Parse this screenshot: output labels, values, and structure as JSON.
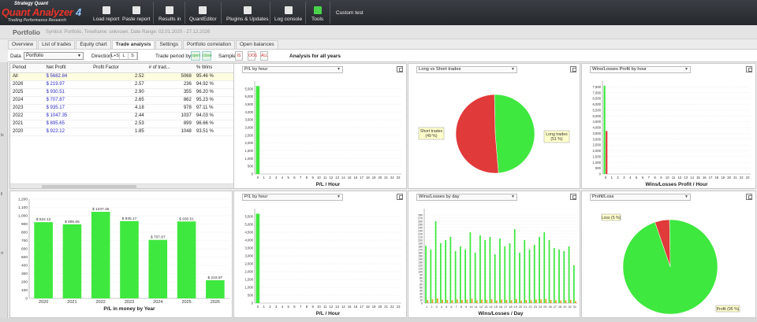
{
  "toolbar": {
    "logo": {
      "line1": "Strategy Quant",
      "line2": "Quant Analyzer",
      "line2_num": "4",
      "line3": "Trading Performance Research"
    },
    "buttons": [
      {
        "label": "Load report",
        "icon": "folder-open-icon"
      },
      {
        "label": "Paste report",
        "icon": "clipboard-icon"
      },
      {
        "label": "Results in",
        "icon": "results-icon"
      },
      {
        "label": "QuantEditor",
        "icon": "editor-icon"
      },
      {
        "label": "Plugins & Updates",
        "icon": "plugin-icon"
      },
      {
        "label": "Log console",
        "icon": "console-icon"
      },
      {
        "label": "Tools",
        "icon": "check-icon"
      },
      {
        "label": "Custom test",
        "icon": ""
      }
    ]
  },
  "header": {
    "title": "Portfolio",
    "meta": "Symbol: Portfolio, Timeframe: unknown, Date Range: 02.01.2020 - 27.12.2026"
  },
  "tabs": [
    "Overview",
    "List of trades",
    "Equity chart",
    "Trade analysis",
    "Settings",
    "Portfolio correlation",
    "Open balances"
  ],
  "active_tab": "Trade analysis",
  "filters": {
    "data_label": "Data",
    "data_value": "Portfolio",
    "direction_label": "Direction",
    "directions": [
      "L+S",
      "L",
      "S"
    ],
    "trade_period_label": "Trade period by",
    "trade_period_open": "open",
    "trade_period_close": "close",
    "sample_label": "Sample",
    "sample_icons": [
      "IS",
      "OOS",
      "ALL"
    ],
    "analysis_title": "Analysis for all years"
  },
  "left_strip": {
    "labels": [
      "ls",
      "ll",
      "rt"
    ]
  },
  "table": {
    "columns": [
      "Period",
      "Net Profit",
      "Profit Factor",
      "# of trad...",
      "% Wins"
    ],
    "rows": [
      [
        "All",
        "$ 5682.84",
        "2.52",
        "5068",
        "95.46 %"
      ],
      [
        "2026",
        "$ 219.97",
        "2.57",
        "236",
        "94.92 %"
      ],
      [
        "2025",
        "$ 930.51",
        "2.90",
        "355",
        "96.20 %"
      ],
      [
        "2024",
        "$ 707.87",
        "2.65",
        "862",
        "95.23 %"
      ],
      [
        "2023",
        "$ 935.17",
        "4.18",
        "978",
        "97.11 %"
      ],
      [
        "2022",
        "$ 1047.35",
        "2.44",
        "1037",
        "94.03 %"
      ],
      [
        "2021",
        "$ 895.65",
        "2.53",
        "899",
        "96.66 %"
      ],
      [
        "2020",
        "$ 922.12",
        "1.85",
        "1048",
        "93.51 %"
      ]
    ]
  },
  "panels": {
    "pl_hour_top": {
      "title": "P/L by hour",
      "xlabel": "P/L / Hour"
    },
    "long_short": {
      "title": "Long vs Short trades",
      "labels": [
        "Short trades",
        "Long trades"
      ],
      "sublabels": [
        "(49 %)",
        "(51 %)"
      ]
    },
    "winloss_hour": {
      "title": "Wins/Losses Profit by hour",
      "xlabel": "Wins/Losses Profit / Hour"
    },
    "pl_year": {
      "xlabel": "P/L in money by Year"
    },
    "pl_hour_bottom": {
      "title": "P/L by hour",
      "xlabel": "P/L / Hour"
    },
    "winloss_day": {
      "title": "Wins/Losses by day",
      "xlabel": "Wins/Losses / Day"
    },
    "profit_loss": {
      "title": "Profit/Loss",
      "labels": [
        "Loss",
        "Profit"
      ],
      "sublabels": [
        "(5 %)",
        "(95 %)"
      ]
    }
  },
  "colors": {
    "green": "#3ee83e",
    "red": "#e03a3a",
    "orange": "#e0a020"
  },
  "chart_data": [
    {
      "type": "bar",
      "id": "pl_hour_top",
      "categories": [
        "0",
        "1",
        "2",
        "3",
        "4",
        "5",
        "6",
        "7",
        "8",
        "9",
        "10",
        "11",
        "12",
        "13",
        "14",
        "15",
        "16",
        "17",
        "18",
        "19",
        "20",
        "21",
        "22",
        "23"
      ],
      "values": [
        5680,
        0,
        0,
        0,
        0,
        0,
        0,
        0,
        0,
        0,
        0,
        0,
        0,
        0,
        0,
        0,
        0,
        0,
        0,
        0,
        0,
        0,
        0,
        0
      ],
      "ylim": [
        0,
        6000
      ],
      "yticks": [
        "0",
        "500",
        "1,000",
        "1,500",
        "2,000",
        "2,500",
        "3,000",
        "3,500",
        "4,000",
        "4,500",
        "5,000",
        "5,500"
      ],
      "xlabel": "P/L / Hour"
    },
    {
      "type": "pie",
      "id": "long_short",
      "labels": [
        "Short trades",
        "Long trades"
      ],
      "values": [
        49,
        51
      ]
    },
    {
      "type": "bar",
      "id": "winloss_hour",
      "categories": [
        "0",
        "1",
        "2",
        "3",
        "4",
        "5",
        "6",
        "7",
        "8",
        "9",
        "10",
        "11",
        "12",
        "13",
        "14",
        "15",
        "16",
        "17",
        "18",
        "19",
        "20",
        "21",
        "22",
        "23"
      ],
      "series": [
        {
          "name": "Wins",
          "values": [
            7600,
            0,
            0,
            0,
            0,
            0,
            0,
            0,
            0,
            0,
            0,
            0,
            0,
            0,
            0,
            0,
            0,
            0,
            0,
            0,
            0,
            0,
            0,
            0
          ]
        },
        {
          "name": "Losses",
          "values": [
            3700,
            0,
            0,
            0,
            0,
            0,
            0,
            0,
            0,
            0,
            0,
            0,
            0,
            0,
            0,
            0,
            0,
            0,
            0,
            0,
            0,
            0,
            0,
            0
          ]
        }
      ],
      "ylim": [
        0,
        8000
      ],
      "yticks": [
        "0",
        "500",
        "1,000",
        "1,500",
        "2,000",
        "2,500",
        "3,000",
        "3,500",
        "4,000",
        "4,500",
        "5,000",
        "5,500",
        "6,000",
        "6,500",
        "7,000",
        "7,500"
      ],
      "xlabel": "Wins/Losses Profit / Hour"
    },
    {
      "type": "bar",
      "id": "pl_year",
      "categories": [
        "2020",
        "2021",
        "2022",
        "2023",
        "2024",
        "2025",
        "2026"
      ],
      "values": [
        922.12,
        895.65,
        1047.35,
        935.17,
        707.87,
        930.51,
        219.97
      ],
      "labels": [
        "$ 922.12",
        "$ 895.65",
        "$ 1047.35",
        "$ 935.17",
        "$ 707.87",
        "$ 930.51",
        "$ 219.97"
      ],
      "ylim": [
        0,
        1200
      ],
      "yticks": [
        "0",
        "100",
        "200",
        "300",
        "400",
        "500",
        "600",
        "700",
        "800",
        "900",
        "1,000",
        "1,100",
        "1,200"
      ],
      "xlabel": "P/L in money by Year"
    },
    {
      "type": "bar",
      "id": "pl_hour_bottom",
      "categories": [
        "0",
        "1",
        "2",
        "3",
        "4",
        "5",
        "6",
        "7",
        "8",
        "9",
        "10",
        "11",
        "12",
        "13",
        "14",
        "15",
        "16",
        "17",
        "18",
        "19",
        "20",
        "21",
        "22",
        "23"
      ],
      "values": [
        5680,
        0,
        0,
        0,
        0,
        0,
        0,
        0,
        0,
        0,
        0,
        0,
        0,
        0,
        0,
        0,
        0,
        0,
        0,
        0,
        0,
        0,
        0,
        0
      ],
      "ylim": [
        0,
        6000
      ],
      "yticks": [
        "0",
        "500",
        "1,000",
        "1,500",
        "2,000",
        "2,500",
        "3,000",
        "3,500",
        "4,000",
        "4,500",
        "5,000",
        "5,500"
      ],
      "xlabel": "P/L / Hour"
    },
    {
      "type": "bar",
      "id": "winloss_day",
      "categories": [
        "1",
        "2",
        "3",
        "4",
        "5",
        "6",
        "7",
        "8",
        "9",
        "10",
        "11",
        "12",
        "13",
        "14",
        "15",
        "16",
        "17",
        "18",
        "19",
        "20",
        "21",
        "22",
        "23",
        "24",
        "25",
        "26",
        "27",
        "28",
        "29",
        "30",
        "31"
      ],
      "series": [
        {
          "name": "Wins",
          "values": [
            182,
            170,
            260,
            190,
            200,
            210,
            165,
            180,
            170,
            225,
            160,
            215,
            200,
            210,
            155,
            205,
            180,
            190,
            235,
            160,
            200,
            170,
            185,
            210,
            225,
            200,
            175,
            170,
            165,
            180,
            120
          ]
        },
        {
          "name": "Losses",
          "values": [
            10,
            12,
            15,
            11,
            10,
            9,
            12,
            10,
            11,
            14,
            9,
            11,
            10,
            12,
            8,
            11,
            10,
            9,
            13,
            8,
            10,
            9,
            11,
            12,
            13,
            10,
            9,
            8,
            9,
            10,
            6
          ]
        }
      ],
      "ylim": [
        0,
        300
      ],
      "yticks": [
        "0",
        "10",
        "20",
        "30",
        "40",
        "50",
        "60",
        "70",
        "80",
        "90",
        "100",
        "110",
        "120",
        "130",
        "140",
        "150",
        "160",
        "170",
        "180",
        "190",
        "200",
        "210",
        "220",
        "230",
        "240",
        "250",
        "260",
        "270",
        "280"
      ],
      "xlabel": "Wins/Losses / Day"
    },
    {
      "type": "pie",
      "id": "profit_loss",
      "labels": [
        "Loss",
        "Profit"
      ],
      "values": [
        5,
        95
      ]
    }
  ]
}
